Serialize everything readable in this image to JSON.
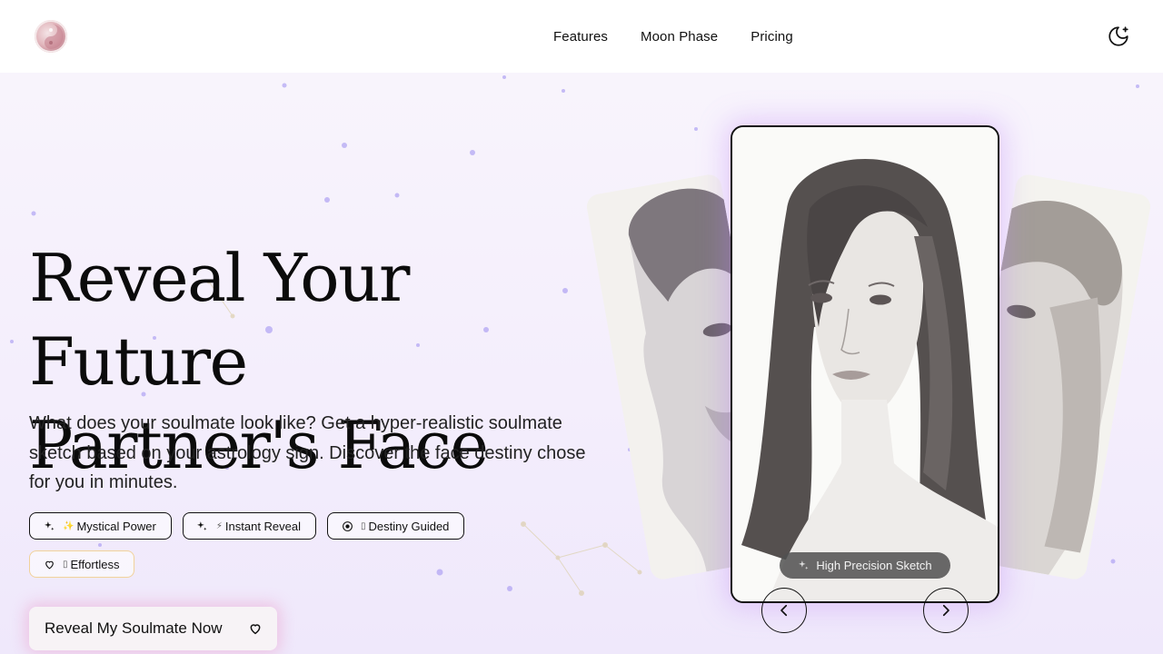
{
  "header": {
    "logo_icon": "yin-yang-logo-icon",
    "nav": [
      {
        "label": "Features"
      },
      {
        "label": "Moon Phase"
      },
      {
        "label": "Pricing"
      }
    ],
    "theme_toggle_icon": "moon-sparkle-icon"
  },
  "hero": {
    "title_line1": "Reveal Your Future",
    "title_line2": "Partner's Face",
    "subtitle": "What does your soulmate look like? Get a hyper-realistic soulmate sketch based on your astrology sign. Discover the face destiny chose for you in minutes.",
    "badges": [
      {
        "label": "Mystical Power",
        "icon": "sparkles-icon",
        "prefix": "✨"
      },
      {
        "label": "Instant Reveal",
        "icon": "sparkles-icon",
        "prefix": "⚡"
      },
      {
        "label": "Destiny Guided",
        "icon": "target-icon",
        "prefix": "▯"
      },
      {
        "label": "Effortless",
        "icon": "heart-icon",
        "prefix": "▯"
      }
    ],
    "cta_label": "Reveal My Soulmate Now",
    "cta_icon": "heart-icon"
  },
  "carousel": {
    "badge_label": "High Precision Sketch",
    "badge_icon": "sparkles-icon",
    "prev_icon": "chevron-left-icon",
    "next_icon": "chevron-right-icon"
  },
  "colors": {
    "accent_glow": "#c888f8",
    "cta_glow": "#ec96c8",
    "text": "#111111"
  }
}
